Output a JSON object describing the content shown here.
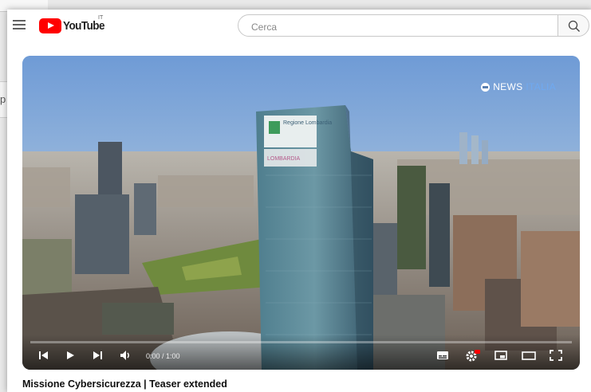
{
  "bg": {
    "edge_letter": "p"
  },
  "header": {
    "logo_text": "YouTube",
    "country_code": "IT",
    "search_placeholder": "Cerca"
  },
  "player": {
    "watermark_brand": "NEWS",
    "watermark_sub": "ITALIA",
    "building_sign_1": "Regione Lombardia",
    "building_sign_2": "LOMBARDIA",
    "time_display": "0:00 / 1:00",
    "progress": 0.0
  },
  "video": {
    "title": "Missione Cybersicurezza | Teaser extended"
  },
  "colors": {
    "accent": "#ff0000"
  }
}
